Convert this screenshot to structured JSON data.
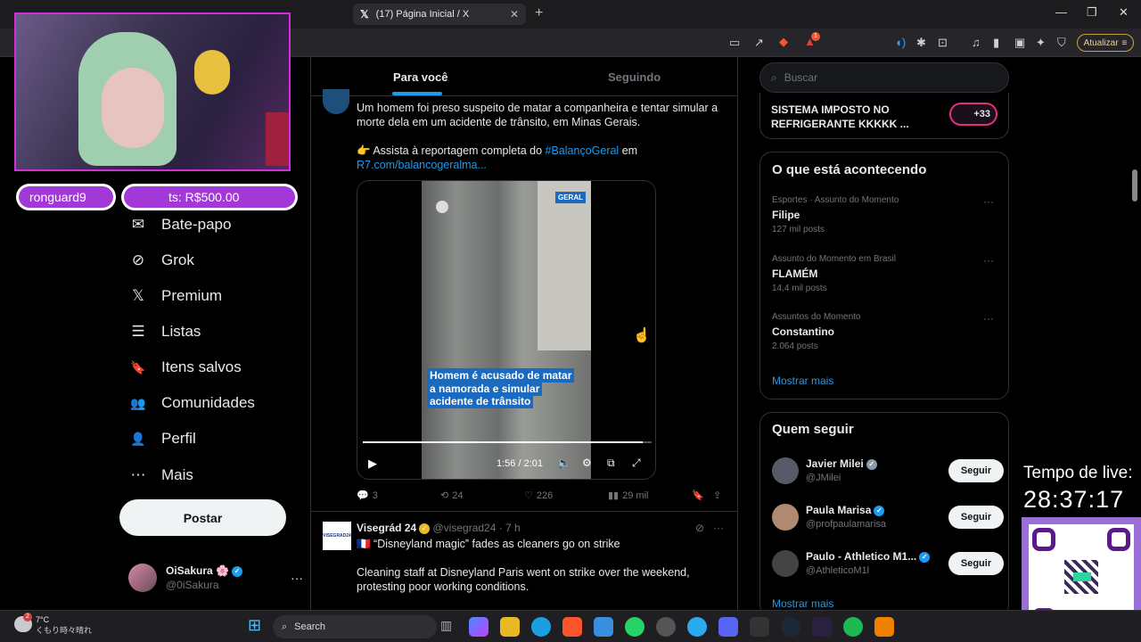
{
  "browser": {
    "tab_title": "(17) Página Inicial / X",
    "tab_close": "✕",
    "new_tab": "+",
    "update_label": "Atualizar",
    "notif_badge": "1",
    "window_controls": [
      "—",
      "❐",
      "✕"
    ]
  },
  "x_nav": {
    "items": [
      {
        "icon": "✉",
        "label": "Bate-papo",
        "icon_name": "mail-icon"
      },
      {
        "icon": "⊘",
        "label": "Grok",
        "icon_name": "grok-icon"
      },
      {
        "icon": "𝕏",
        "label": "Premium",
        "icon_name": "x-premium-icon"
      },
      {
        "icon": "☰",
        "label": "Listas",
        "icon_name": "list-icon"
      },
      {
        "icon": "🔖",
        "label": "Itens salvos",
        "icon_name": "bookmark-icon"
      },
      {
        "icon": "👥",
        "label": "Comunidades",
        "icon_name": "communities-icon"
      },
      {
        "icon": "👤",
        "label": "Perfil",
        "icon_name": "profile-icon"
      },
      {
        "icon": "⋯",
        "label": "Mais",
        "icon_name": "more-icon"
      }
    ],
    "post_button": "Postar",
    "profile": {
      "name": "OiSakura 🌸",
      "handle": "@0iSakura",
      "more": "···"
    }
  },
  "timeline": {
    "tabs": [
      "Para você",
      "Seguindo"
    ],
    "tweet1": {
      "text_line1": "Um homem foi preso suspeito de matar a companheira e tentar simular a",
      "text_line2": "morte dela em um acidente de trânsito, em Minas Gerais.",
      "cta_prefix": "👉 Assista à reportagem completa do",
      "cta_hashtag": "#BalançoGeral",
      "cta_suffix": "em",
      "link": "R7.com/balancogeralma...",
      "video": {
        "badge": "GERAL",
        "caption": [
          "Homem é acusado de matar",
          "a namorada e simular",
          "acidente de trânsito"
        ],
        "time": "1:56 / 2:01",
        "progress": 0.97
      },
      "replies": "3",
      "retweets": "24",
      "likes": "226",
      "views": "29 mil"
    },
    "tweet2": {
      "author": "Visegrád 24",
      "handle": "@visegrad24 · 7 h",
      "logo_text": "VISEGRAD24",
      "line1": "🇫🇷 “Disneyland magic” fades as cleaners go on strike",
      "line2": "Cleaning staff at Disneyland Paris went on strike over the weekend,",
      "line3": "protesting poor working conditions."
    }
  },
  "sidebar": {
    "search_placeholder": "Buscar",
    "top_trend": {
      "text_line1": "SISTEMA  IMPOSTO NO",
      "text_line2": "REFRIGERANTE KKKKK ...",
      "badge": "+33"
    },
    "happening": {
      "title": "O que está acontecendo",
      "trends": [
        {
          "meta": "Esportes · Assunto do Momento",
          "name": "Filipe",
          "posts": "127 mil posts"
        },
        {
          "meta": "Assunto do Momento em Brasil",
          "name": "FLAMÉM",
          "posts": "14,4 mil posts"
        },
        {
          "meta": "Assuntos do Momento",
          "name": "Constantino",
          "posts": "2.064 posts"
        }
      ],
      "show_more": "Mostrar mais"
    },
    "who_to_follow": {
      "title": "Quem seguir",
      "users": [
        {
          "name": "Javier Milei",
          "handle": "@JMilei",
          "button": "Seguir"
        },
        {
          "name": "Paula Marisa",
          "handle": "@profpaulamarisa",
          "button": "Seguir"
        },
        {
          "name": "Paulo - Athletico M1...",
          "handle": "@AthleticoM1l",
          "button": "Seguir"
        }
      ],
      "show_more": "Mostrar mais"
    }
  },
  "overlay": {
    "user_pill": "ronguard9",
    "donation_pill": "ts: R$500.00",
    "live_label": "Tempo de live:",
    "live_time": "28:37:17"
  },
  "taskbar": {
    "weather_temp": "7°C",
    "weather_desc": "くもり時々晴れ",
    "weather_badge": "2",
    "search": "Search"
  }
}
